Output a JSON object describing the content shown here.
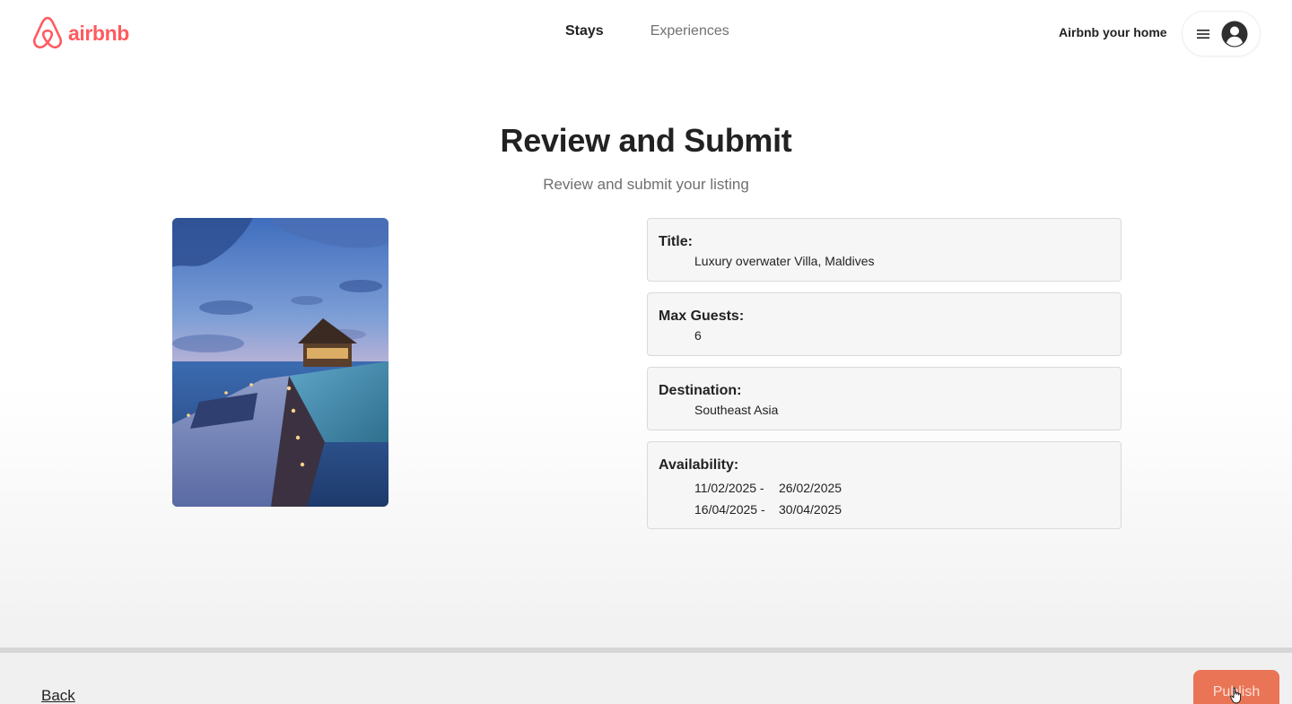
{
  "colors": {
    "brand": "#ff5a5f",
    "publish_button": "#e97556",
    "card_background": "#f6f6f6"
  },
  "header": {
    "logo_text": "airbnb",
    "nav": [
      {
        "label": "Stays"
      },
      {
        "label": "Experiences"
      }
    ],
    "host_link": "Airbnb your home",
    "icons": [
      "airbnb-logo-icon",
      "hamburger-icon",
      "avatar-icon"
    ]
  },
  "main": {
    "title": "Review and Submit",
    "subtitle": "Review and submit your listing",
    "photo": "overwater villa with pool at dusk, Maldives",
    "fields": {
      "title": {
        "label": "Title:",
        "value": "Luxury overwater Villa, Maldives"
      },
      "max_guests": {
        "label": "Max Guests:",
        "value": "6"
      },
      "destination": {
        "label": "Destination:",
        "value": "Southeast Asia"
      },
      "availability": {
        "label": "Availability:",
        "ranges": [
          {
            "start": "11/02/2025 -",
            "end": "26/02/2025"
          },
          {
            "start": "16/04/2025 -",
            "end": "30/04/2025"
          }
        ]
      }
    }
  },
  "footer": {
    "back_label": "Back",
    "publish_label": "Publish"
  }
}
